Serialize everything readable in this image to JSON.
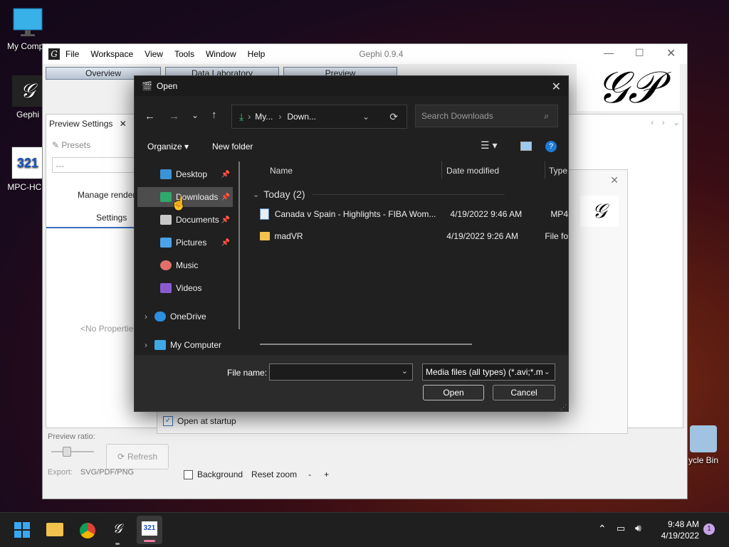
{
  "desktop": {
    "icons": [
      {
        "label": "My Compu"
      },
      {
        "label": "Gephi"
      },
      {
        "label": "MPC-HC x"
      },
      {
        "label": "ycle Bin"
      }
    ]
  },
  "gephi": {
    "menu": [
      "File",
      "Workspace",
      "View",
      "Tools",
      "Window",
      "Help"
    ],
    "title": "Gephi 0.9.4",
    "tabs": [
      "Overview",
      "Data Laboratory",
      "Preview"
    ],
    "preview_settings_tab": "Preview Settings",
    "presets_label": "Presets",
    "presets_value": "---",
    "manage_renderers": "Manage render",
    "settings_tab": "Settings",
    "no_properties": "<No Properties",
    "preview_ratio": "Preview ratio:",
    "refresh": "Refresh",
    "export_label": "Export:",
    "export_formats": "SVG/PDF/PNG",
    "background_label": "Background",
    "reset_zoom": "Reset zoom",
    "zoom_minus": "-",
    "zoom_plus": "+",
    "open_at_startup": "Open at startup"
  },
  "dialog": {
    "title": "Open",
    "breadcrumb": [
      "My...",
      "Down..."
    ],
    "search_placeholder": "Search Downloads",
    "organize": "Organize",
    "new_folder": "New folder",
    "sidebar": [
      {
        "label": "Desktop",
        "pinned": true
      },
      {
        "label": "Downloads",
        "pinned": true
      },
      {
        "label": "Documents",
        "pinned": true
      },
      {
        "label": "Pictures",
        "pinned": true
      },
      {
        "label": "Music",
        "pinned": false
      },
      {
        "label": "Videos",
        "pinned": false
      },
      {
        "label": "OneDrive",
        "pinned": false
      },
      {
        "label": "My Computer",
        "pinned": false
      }
    ],
    "columns": [
      "Name",
      "Date modified",
      "Type"
    ],
    "group_label": "Today (2)",
    "files": [
      {
        "name": "Canada v Spain - Highlights - FIBA Wom...",
        "date": "4/19/2022 9:46 AM",
        "type": "MP4"
      },
      {
        "name": "madVR",
        "date": "4/19/2022 9:26 AM",
        "type": "File fo"
      }
    ],
    "file_name_label": "File name:",
    "file_name_value": "",
    "file_type_value": "Media files (all types) (*.avi;*.m",
    "open_button": "Open",
    "cancel_button": "Cancel"
  },
  "taskbar": {
    "time": "9:48 AM",
    "date": "4/19/2022",
    "notification_count": "1"
  }
}
